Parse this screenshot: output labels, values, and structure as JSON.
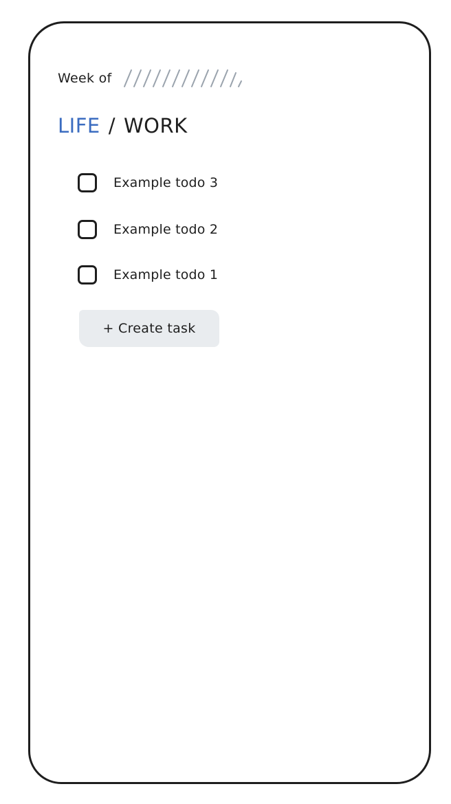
{
  "header": {
    "week_label": "Week of"
  },
  "tabs": {
    "life_label": "LIFE",
    "separator": "/",
    "work_label": "WORK",
    "active": "LIFE"
  },
  "todos": [
    {
      "label": "Example todo 3",
      "checked": false
    },
    {
      "label": "Example todo 2",
      "checked": false
    },
    {
      "label": "Example todo 1",
      "checked": false
    }
  ],
  "actions": {
    "create_task_label": "+ Create task"
  },
  "colors": {
    "accent": "#3b6cc0",
    "ink": "#1e1e1e",
    "button_bg": "#e9ecef",
    "hatch": "#9aa3ad"
  }
}
